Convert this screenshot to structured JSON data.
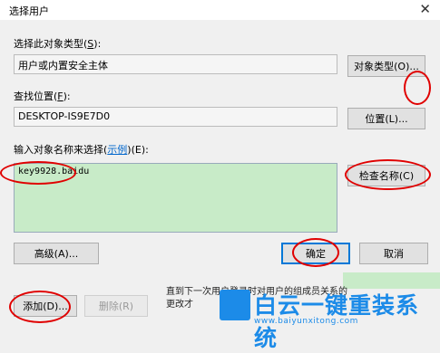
{
  "window": {
    "title": "选择用户",
    "close_glyph": "✕"
  },
  "object_type": {
    "label_prefix": "选择此对象类型(",
    "label_key": "S",
    "label_suffix": "):",
    "value": "用户或内置安全主体",
    "button": "对象类型(O)..."
  },
  "location": {
    "label_prefix": "查找位置(",
    "label_key": "F",
    "label_suffix": "):",
    "value": "DESKTOP-IS9E7D0",
    "button": "位置(L)..."
  },
  "names": {
    "label_prefix": "输入对象名称来选择(",
    "label_link": "示例",
    "label_suffix": ")(E):",
    "value": "key9928.baidu",
    "check_button": "检查名称(C)"
  },
  "footer": {
    "advanced_button": "高级(A)...",
    "ok_button": "确定",
    "cancel_button": "取消"
  },
  "behind": {
    "add_button": "添加(D)...",
    "remove_button": "删除(R)",
    "info_text": "直到下一次用户登录时对用户的组成员关系的更改才"
  },
  "watermark": {
    "name": "白云一键重装系统",
    "url": "www.baiyunxitong.com"
  },
  "colors": {
    "highlight": "#c8ebc8",
    "annotation": "#e00000",
    "accent": "#0078d7"
  }
}
